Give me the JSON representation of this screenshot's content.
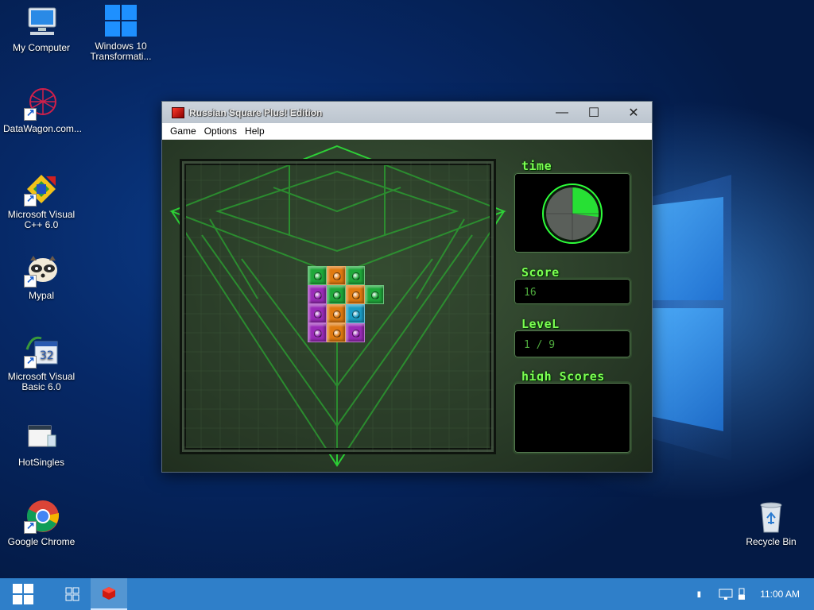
{
  "desktop": {
    "icons": [
      {
        "label": "My Computer",
        "icon": "computer-icon"
      },
      {
        "label": "Windows 10 Transformati...",
        "icon": "windows-logo-icon"
      },
      {
        "label": "DataWagon.com...",
        "icon": "datawagon-icon"
      },
      {
        "label": "Microsoft Visual C++ 6.0",
        "icon": "visual-cpp-icon"
      },
      {
        "label": "Mypal",
        "icon": "mypal-raccoon-icon"
      },
      {
        "label": "Microsoft Visual Basic 6.0",
        "icon": "visual-basic-icon"
      },
      {
        "label": "HotSingles",
        "icon": "folder-icon"
      },
      {
        "label": "Google Chrome",
        "icon": "chrome-icon"
      },
      {
        "label": "Recycle Bin",
        "icon": "recycle-bin-icon"
      }
    ]
  },
  "window": {
    "title": "Russian Square Plus! Edition",
    "controls": {
      "minimize": "—",
      "maximize": "☐",
      "close": "✕"
    },
    "menu": [
      "Game",
      "Options",
      "Help"
    ]
  },
  "game": {
    "time_label": "time",
    "time_fraction": 0.27,
    "score_label": "Score",
    "score_value": "16",
    "level_label": "LeveL",
    "level_value": "1 / 9",
    "highscores_label": "high Scores",
    "blocks": [
      {
        "row": 0,
        "col": 0,
        "color": "green"
      },
      {
        "row": 0,
        "col": 1,
        "color": "orange"
      },
      {
        "row": 0,
        "col": 2,
        "color": "green"
      },
      {
        "row": 1,
        "col": 0,
        "color": "purple"
      },
      {
        "row": 1,
        "col": 1,
        "color": "green"
      },
      {
        "row": 1,
        "col": 2,
        "color": "orange"
      },
      {
        "row": 1,
        "col": 3,
        "color": "green"
      },
      {
        "row": 2,
        "col": 0,
        "color": "purple"
      },
      {
        "row": 2,
        "col": 1,
        "color": "orange"
      },
      {
        "row": 2,
        "col": 2,
        "color": "cyan"
      },
      {
        "row": 3,
        "col": 0,
        "color": "purple"
      },
      {
        "row": 3,
        "col": 1,
        "color": "orange"
      },
      {
        "row": 3,
        "col": 2,
        "color": "purple"
      }
    ],
    "colors": {
      "green": "#1fa83a",
      "orange": "#e07a10",
      "purple": "#9a2bb8",
      "cyan": "#1a9cc4",
      "accent": "#7cff52"
    }
  },
  "taskbar": {
    "clock": "11:00 AM",
    "items": [
      "start-icon",
      "task-view-icon",
      "russian-square-app-icon"
    ]
  }
}
